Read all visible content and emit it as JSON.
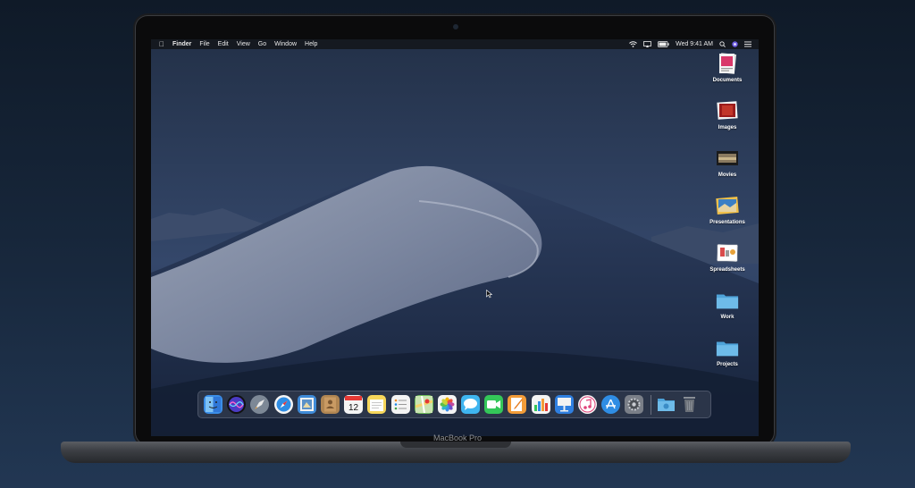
{
  "device": {
    "brand_label": "MacBook Pro"
  },
  "menubar": {
    "items": [
      "Finder",
      "File",
      "Edit",
      "View",
      "Go",
      "Window",
      "Help"
    ],
    "clock": "Wed 9:41 AM"
  },
  "desktop": {
    "icons": [
      {
        "label": "Documents",
        "icon": "documents-stack-icon"
      },
      {
        "label": "Images",
        "icon": "images-stack-icon"
      },
      {
        "label": "Movies",
        "icon": "movies-stack-icon"
      },
      {
        "label": "Presentations",
        "icon": "presentations-stack-icon"
      },
      {
        "label": "Spreadsheets",
        "icon": "spreadsheets-stack-icon"
      },
      {
        "label": "Work",
        "icon": "folder-icon"
      },
      {
        "label": "Projects",
        "icon": "folder-icon"
      }
    ]
  },
  "dock": {
    "calendar_day": "12",
    "apps": [
      "finder",
      "siri",
      "launchpad",
      "safari",
      "mail",
      "contacts",
      "calendar",
      "notes",
      "reminders",
      "maps",
      "photos",
      "messages",
      "facetime",
      "pages",
      "numbers",
      "keynote",
      "itunes",
      "app-store",
      "system-preferences"
    ],
    "colors": {
      "finder": "#3b8ee8",
      "siri": "#5b4bd6",
      "launchpad": "#7d8896",
      "safari": "#2f8de4",
      "mail": "#3f8bd8",
      "contacts": "#b08552",
      "calendar": "#f4f4f4",
      "notes": "#f6d65a",
      "reminders": "#f4f4f4",
      "maps": "#6dbb5b",
      "photos": "#f4f4f4",
      "messages": "#3fb5f0",
      "facetime": "#34c759",
      "pages": "#f39c38",
      "numbers": "#34c759",
      "keynote": "#2f7fe0",
      "itunes": "#f4f4f4",
      "app-store": "#2f8de4",
      "system-preferences": "#7a7f88",
      "downloads": "#5da7d8",
      "trash": "#8a8f96"
    }
  }
}
